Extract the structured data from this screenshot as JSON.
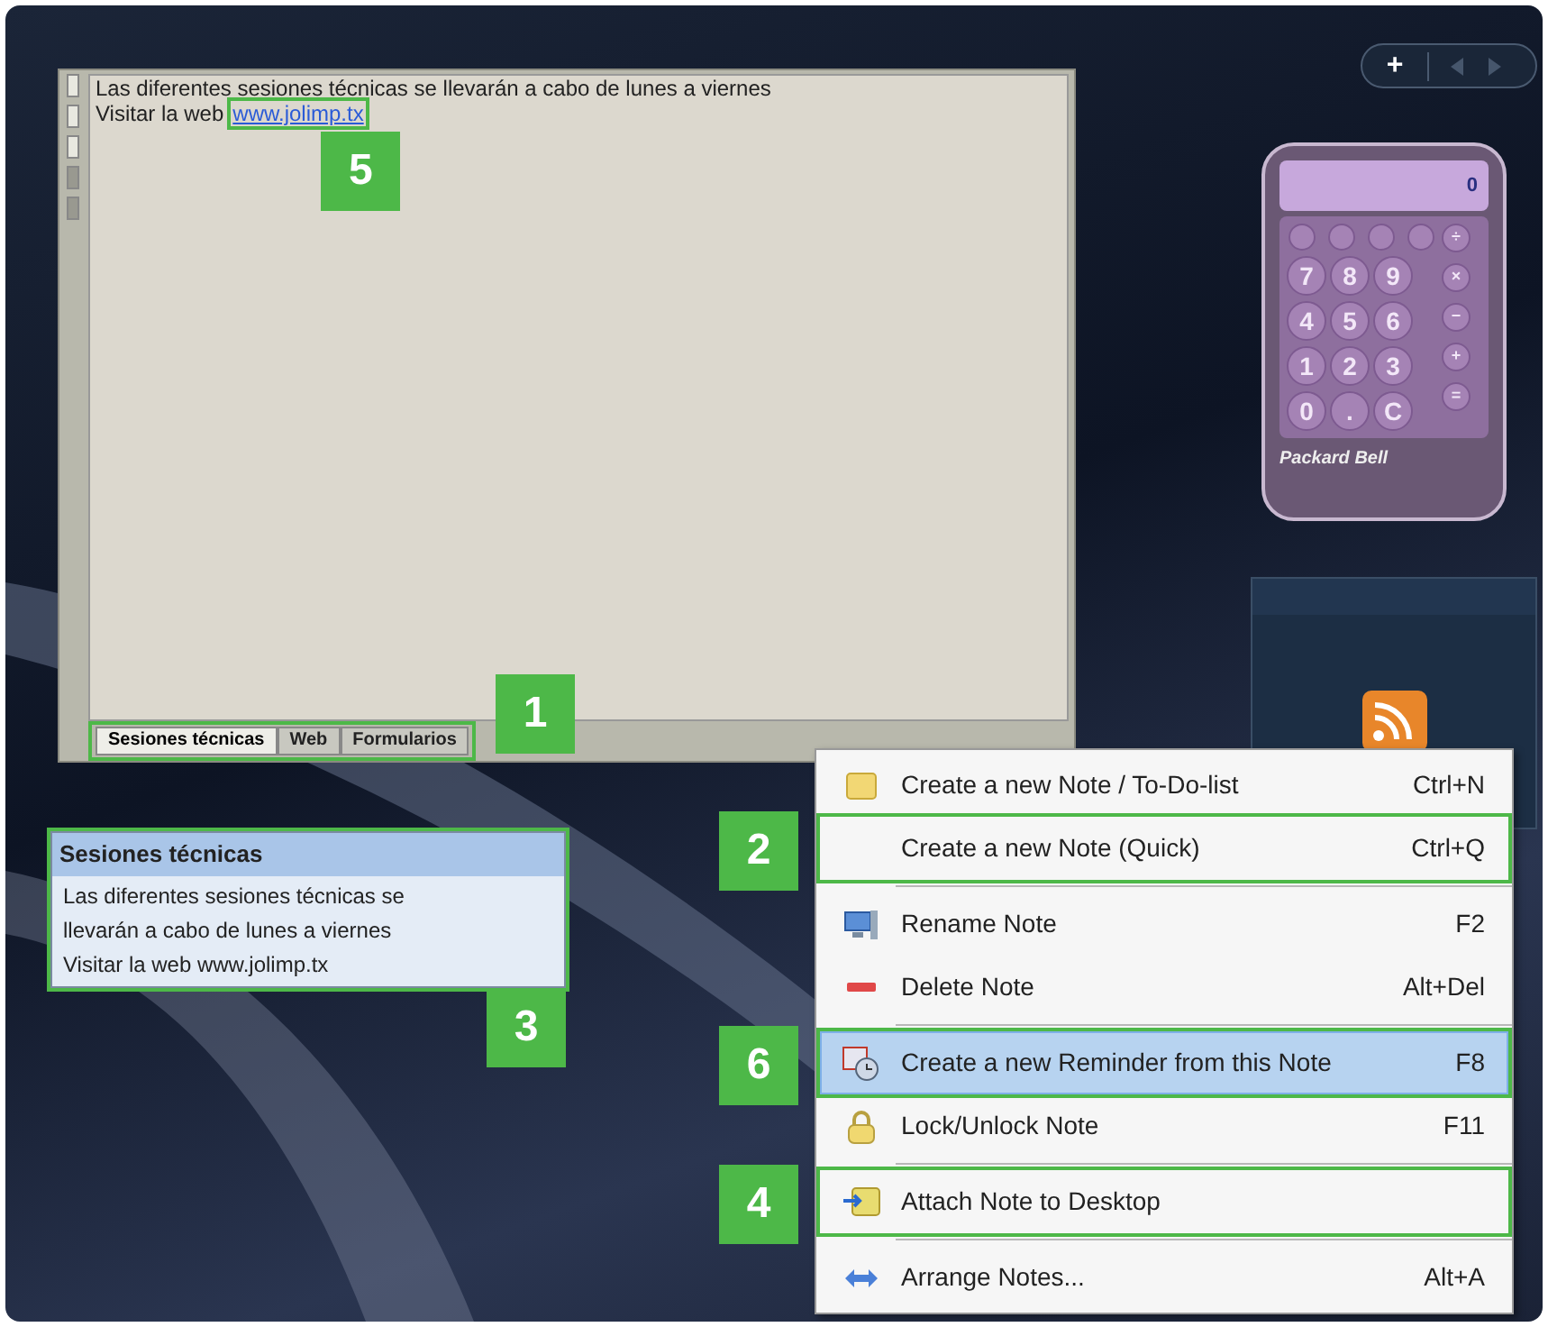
{
  "note_window": {
    "lines": [
      "Las diferentes sesiones técnicas se llevarán a cabo de lunes a viernes"
    ],
    "link_prefix": "Visitar la web",
    "link": {
      "text": "www.jolimp.tx",
      "callout": "5"
    },
    "side_markers": [
      {
        "filled": false
      },
      {
        "filled": false
      },
      {
        "filled": false
      },
      {
        "filled": true
      },
      {
        "filled": true
      }
    ],
    "tabs": {
      "callout": "1",
      "items": [
        {
          "label": "Sesiones técnicas",
          "selected": true
        },
        {
          "label": "Web",
          "selected": false
        },
        {
          "label": "Formularios",
          "selected": false
        }
      ]
    }
  },
  "preview": {
    "callout": "3",
    "title": "Sesiones técnicas",
    "lines": [
      "Las diferentes sesiones técnicas se",
      "llevarán a cabo de lunes a viernes",
      "Visitar la web www.jolimp.tx"
    ]
  },
  "gadget_bar": {
    "add": "+"
  },
  "calculator": {
    "display": "0",
    "brand": "Packard Bell",
    "rows": [
      [
        "7",
        "8",
        "9"
      ],
      [
        "4",
        "5",
        "6"
      ],
      [
        "1",
        "2",
        "3"
      ],
      [
        "0",
        ".",
        "C"
      ]
    ],
    "operators": [
      "÷",
      "×",
      "−",
      "+",
      "="
    ]
  },
  "context_menu": [
    {
      "kind": "note",
      "label": "Create a new Note / To-Do-list",
      "shortcut": "Ctrl+N",
      "selected": false,
      "separator_after": false
    },
    {
      "kind": "none",
      "label": "Create a new Note (Quick)",
      "shortcut": "Ctrl+Q",
      "selected": false,
      "separator_after": true,
      "callout": "2"
    },
    {
      "kind": "rename",
      "label": "Rename Note",
      "shortcut": "F2",
      "selected": false,
      "separator_after": false
    },
    {
      "kind": "delete",
      "label": "Delete Note",
      "shortcut": "Alt+Del",
      "selected": false,
      "separator_after": true
    },
    {
      "kind": "reminder",
      "label": "Create a new Reminder from this Note",
      "shortcut": "F8",
      "selected": true,
      "separator_after": false,
      "callout": "6"
    },
    {
      "kind": "lock",
      "label": "Lock/Unlock Note",
      "shortcut": "F11",
      "selected": false,
      "separator_after": true
    },
    {
      "kind": "attach",
      "label": "Attach Note to Desktop",
      "selected": false,
      "separator_after": true,
      "callout": "4"
    },
    {
      "kind": "arrange",
      "label": "Arrange Notes...",
      "shortcut": "Alt+A",
      "selected": false,
      "separator_after": false
    }
  ]
}
